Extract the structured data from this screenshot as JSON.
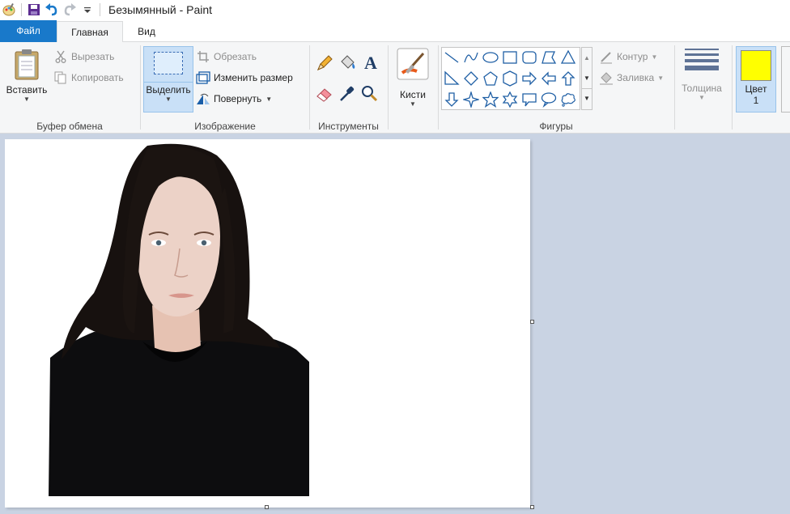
{
  "window": {
    "title": "Безымянный - Paint"
  },
  "quick_access": {
    "icons": [
      "paint-app-icon",
      "save-icon",
      "undo-icon",
      "redo-icon",
      "customize-dropdown-icon"
    ]
  },
  "tabs": {
    "file": "Файл",
    "home": "Главная",
    "view": "Вид"
  },
  "clipboard": {
    "paste": "Вставить",
    "cut": "Вырезать",
    "copy": "Копировать",
    "label": "Буфер обмена"
  },
  "image": {
    "select": "Выделить",
    "crop": "Обрезать",
    "resize": "Изменить размер",
    "rotate": "Повернуть",
    "label": "Изображение"
  },
  "tools": {
    "label": "Инструменты",
    "items": [
      "pencil-icon",
      "fill-icon",
      "text-icon",
      "eraser-icon",
      "color-picker-icon",
      "magnifier-icon"
    ]
  },
  "brushes": {
    "label": "Кисти"
  },
  "shapes": {
    "label": "Фигуры",
    "outline": "Контур",
    "fill": "Заливка",
    "items": [
      "line",
      "curve",
      "oval",
      "rectangle",
      "rounded-rectangle",
      "polygon",
      "triangle",
      "right-triangle",
      "diamond",
      "pentagon",
      "hexagon",
      "right-arrow",
      "left-arrow",
      "up-arrow",
      "down-arrow",
      "four-point-star",
      "five-point-star",
      "six-point-star",
      "rect-callout",
      "oval-callout",
      "cloud-callout"
    ]
  },
  "size": {
    "label": "Толщина"
  },
  "color1": {
    "label": "Цвет",
    "number": "1",
    "value": "#ffff00"
  },
  "colors": {
    "accent": "#1979ca",
    "ribbon_bg": "#f5f6f7",
    "workspace_bg": "#c9d3e3"
  }
}
